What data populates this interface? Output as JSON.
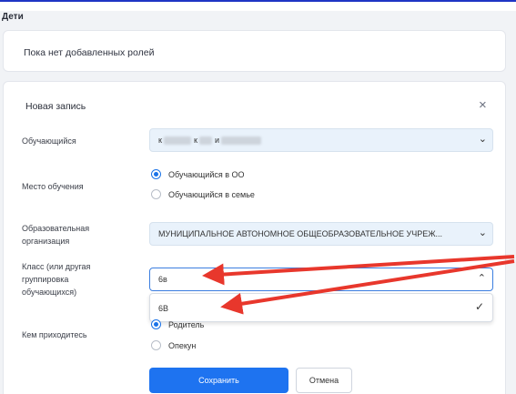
{
  "section_title": "Дети",
  "roles": {
    "empty_text": "Пока нет добавленных ролей"
  },
  "entry": {
    "title": "Новая запись",
    "close_label": "×",
    "student": {
      "label": "Обучающийся",
      "value_parts": [
        "к",
        "к",
        "и"
      ]
    },
    "study_place": {
      "label": "Место обучения",
      "options": [
        {
          "label": "Обучающийся в ОО",
          "selected": true
        },
        {
          "label": "Обучающийся в семье",
          "selected": false
        }
      ]
    },
    "organization": {
      "label_line1": "Образовательная",
      "label_line2": "организация",
      "value": "МУНИЦИПАЛЬНОЕ АВТОНОМНОЕ ОБЩЕОБРАЗОВАТЕЛЬНОЕ УЧРЕЖ..."
    },
    "class": {
      "label_line1": "Класс (или другая",
      "label_line2": "группировка",
      "label_line3": "обучающихся)",
      "value": "6в",
      "dropdown_option": "6В"
    },
    "relation": {
      "label": "Кем приходитесь",
      "options": [
        {
          "label": "Родитель",
          "selected": true
        },
        {
          "label": "Опекун",
          "selected": false
        }
      ]
    },
    "save_label": "Сохранить",
    "cancel_label": "Отмена"
  },
  "colors": {
    "accent": "#1e73f0",
    "annotation": "#e8372c",
    "top_border": "#1f35c4"
  }
}
